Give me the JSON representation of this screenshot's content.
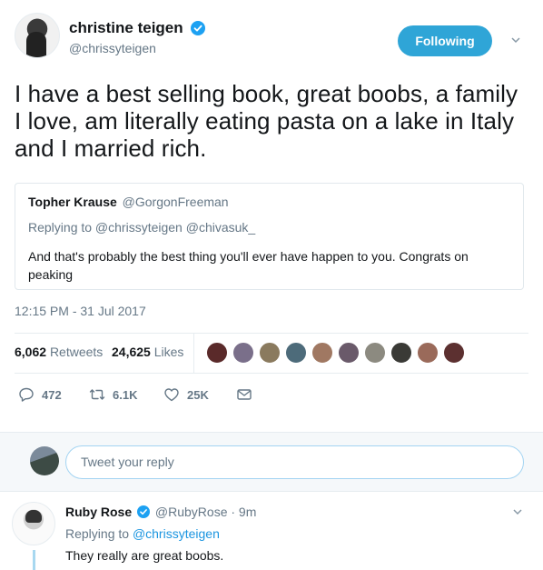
{
  "tweet": {
    "display_name": "christine teigen",
    "handle": "@chrissyteigen",
    "follow_label": "Following",
    "text": "I have a best selling book, great boobs, a family I love, am literally eating pasta on a lake in Italy and I married rich.",
    "timestamp": "12:15 PM - 31 Jul 2017"
  },
  "quote": {
    "author": "Topher Krause",
    "handle": "@GorgonFreeman",
    "reply_prefix": "Replying to @chrissyteigen @chivasuk_",
    "text": "And that's probably the best thing you'll ever have happen to you. Congrats on peaking"
  },
  "stats": {
    "retweets_count": "6,062",
    "retweets_label": "Retweets",
    "likes_count": "24,625",
    "likes_label": "Likes"
  },
  "likers": [
    "#5a2a2a",
    "#7a6f8a",
    "#8a7a5e",
    "#4d6b7a",
    "#a07862",
    "#6a5a6a",
    "#8c8a80",
    "#3a3a36",
    "#9a6a5a",
    "#5c3030"
  ],
  "actions": {
    "reply_count": "472",
    "retweet_count": "6.1K",
    "like_count": "25K"
  },
  "reply_box": {
    "placeholder": "Tweet your reply"
  },
  "reply_tweet": {
    "display_name": "Ruby Rose",
    "handle": "@RubyRose",
    "time": "· 9m",
    "replying_prefix": "Replying to",
    "replying_to": "@chrissyteigen",
    "text": "They really are great boobs."
  },
  "colors": {
    "accent": "#1da1f2",
    "follow_button": "#2fa5d7",
    "muted": "#657786"
  }
}
